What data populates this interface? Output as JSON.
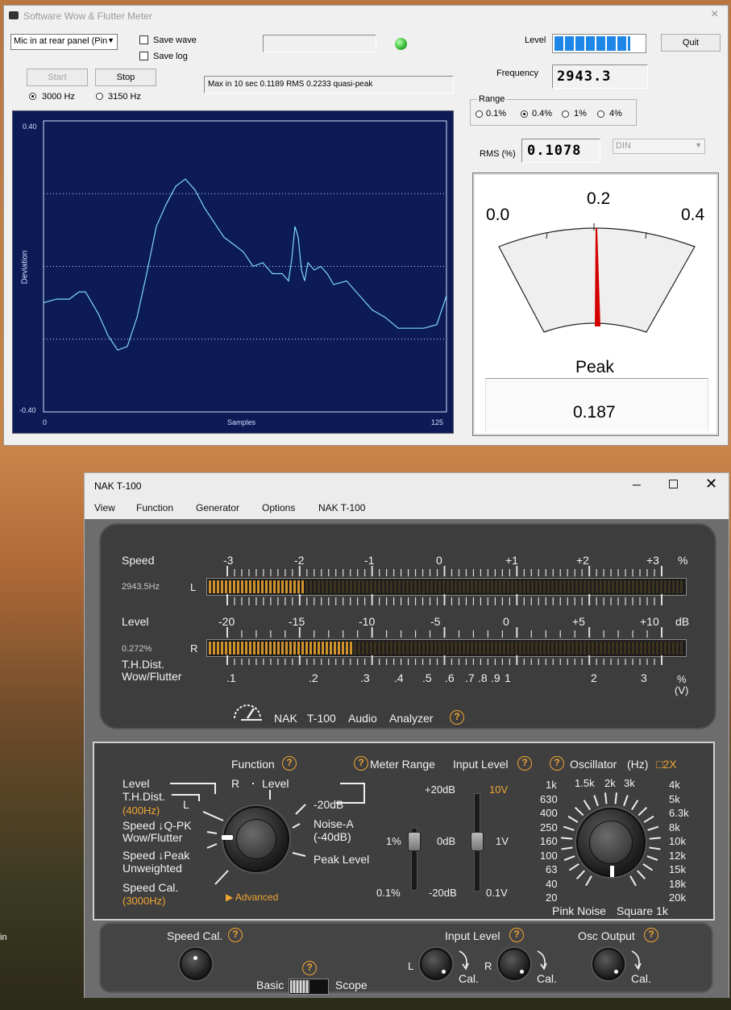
{
  "wf": {
    "title": "Software Wow & Flutter Meter",
    "close": "×",
    "input_select": "Mic in at rear panel (Pin",
    "save_wave": "Save wave",
    "save_log": "Save log",
    "start": "Start",
    "stop": "Stop",
    "freq_3000": "3000 Hz",
    "freq_3150": "3150 Hz",
    "selected_freq": "3000 Hz",
    "status_text": "Max in 10 sec 0.1189 RMS 0.2233 quasi-peak",
    "level_label": "Level",
    "level_fraction": 0.85,
    "quit": "Quit",
    "frequency_label": "Frequency",
    "frequency_value": "2943.3",
    "range_label": "Range",
    "ranges": [
      "0.1%",
      "0.4%",
      "1%",
      "4%"
    ],
    "selected_range": "0.4%",
    "rms_label": "RMS (%)",
    "rms_value": "0.1078",
    "weighting": "DIN",
    "meter_scale": [
      "0.0",
      "0.2",
      "0.4"
    ],
    "meter_needle_value": 0.2,
    "peak_label": "Peak",
    "peak_value": "0.187",
    "indicator_color": "#2fb82f"
  },
  "chart_data": {
    "type": "line",
    "xlabel": "Samples",
    "ylabel": "Deviation",
    "xlim": [
      0,
      125
    ],
    "ylim": [
      -0.4,
      0.4
    ],
    "y_tick_labels": [
      "0.40",
      "-0.40"
    ],
    "x_tick_labels": [
      "0",
      "125"
    ],
    "grid": "dotted horizontal at -0.20, 0.00, 0.20",
    "series": [
      {
        "color": "#7fd6ff",
        "x": [
          0,
          4,
          8,
          11,
          13,
          15,
          17,
          20,
          23,
          26,
          29,
          32,
          35,
          38,
          41,
          44,
          47,
          50,
          53,
          56,
          59,
          62,
          65,
          68,
          71,
          74,
          76,
          77,
          78,
          79,
          80,
          81,
          82,
          83,
          84,
          86,
          88,
          90,
          94,
          98,
          102,
          106,
          110,
          114,
          118,
          122,
          125
        ],
        "y": [
          -0.1,
          -0.09,
          -0.09,
          -0.07,
          -0.07,
          -0.1,
          -0.13,
          -0.19,
          -0.23,
          -0.22,
          -0.14,
          -0.02,
          0.11,
          0.17,
          0.22,
          0.24,
          0.21,
          0.16,
          0.12,
          0.08,
          0.06,
          0.04,
          0.0,
          0.01,
          -0.02,
          -0.02,
          -0.04,
          0.02,
          0.11,
          0.08,
          -0.01,
          -0.04,
          0.01,
          0.0,
          -0.01,
          0.0,
          -0.02,
          -0.05,
          -0.04,
          -0.08,
          -0.12,
          -0.14,
          -0.17,
          -0.17,
          -0.17,
          -0.16,
          -0.08
        ]
      }
    ]
  },
  "nak": {
    "title": "NAK T-100",
    "menu": [
      "View",
      "Function",
      "Generator",
      "Options",
      "NAK T-100"
    ],
    "speed_label": "Speed",
    "speed_ticks": [
      "-3",
      "-2",
      "-1",
      "0",
      "+1",
      "+2",
      "+3",
      "%"
    ],
    "speed_freq": "2943.5Hz",
    "channel_L": "L",
    "speed_fill": 0.2,
    "level_label": "Level",
    "level_ticks": [
      "-20",
      "-15",
      "-10",
      "-5",
      "0",
      "+5",
      "+10",
      "dB"
    ],
    "level_pct": "0.272%",
    "channel_R": "R",
    "level_fill": 0.3,
    "thd_label": "T.H.Dist.",
    "wf_label": "Wow/Flutter",
    "pct_ticks": [
      ".1",
      ".2",
      ".3",
      ".4",
      ".5",
      ".6",
      ".7",
      ".8",
      ".9",
      "1",
      "2",
      "3"
    ],
    "pct_unit": "%",
    "v_unit": "(V)",
    "brand": "NAK",
    "model": "T-100",
    "audio": "Audio",
    "analyzer": "Analyzer",
    "q": "?",
    "function_title": "Function",
    "meter_range_title": "Meter Range",
    "input_level_title": "Input Level",
    "oscillator_title": "Oscillator",
    "hz": "(Hz)",
    "x2": "□2X",
    "fn_left": [
      "Level",
      "T.H.Dist.",
      "(400Hz)",
      "Speed ↓Q-PK",
      "Wow/Flutter",
      "Speed ↓Peak",
      "Unweighted",
      "Speed Cal.",
      "(3000Hz)"
    ],
    "fn_R": "R",
    "fn_L": "L",
    "fn_level": "Level",
    "fn_right": [
      "-20dB",
      "Noise-A",
      "(-40dB)",
      "Peak Level"
    ],
    "advanced": "▶ Advanced",
    "range_labels": [
      "+20dB",
      "1%",
      "0dB",
      "0.1%",
      "-20dB"
    ],
    "input_labels": [
      "10V",
      "1V",
      "0.1V"
    ],
    "osc_left": [
      "1k",
      "630",
      "400",
      "250",
      "160",
      "100",
      "63",
      "40",
      "20"
    ],
    "osc_top": [
      "1.5k",
      "2k",
      "3k"
    ],
    "osc_right": [
      "4k",
      "5k",
      "6.3k",
      "8k",
      "10k",
      "12k",
      "15k",
      "18k",
      "20k"
    ],
    "pink": "Pink Noise",
    "square": "Square 1k",
    "speed_cal": "Speed Cal.",
    "basic": "Basic",
    "scope": "Scope",
    "input_level": "Input Level",
    "cal": "Cal.",
    "osc_output": "Osc Output"
  },
  "desktop": {
    "edge_text": "in"
  }
}
